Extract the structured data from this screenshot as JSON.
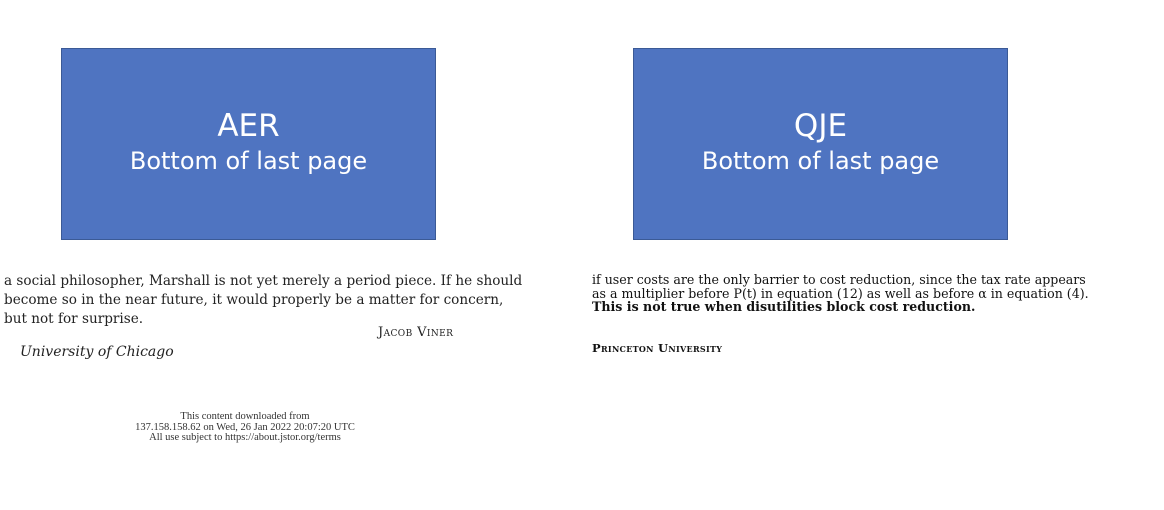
{
  "panels": {
    "aer": {
      "title": "AER",
      "subtitle": "Bottom of last page"
    },
    "qje": {
      "title": "QJE",
      "subtitle": "Bottom of last page"
    }
  },
  "aer_excerpt": {
    "lines": [
      "a social philosopher, Marshall is not yet merely a period piece. If he should",
      "become so in the near future, it would properly be a matter for concern,",
      "but not for surprise."
    ],
    "author": "Jacob Viner",
    "affiliation": "University of Chicago",
    "jstor_notice": [
      "This content downloaded from",
      "137.158.158.62 on Wed, 26 Jan 2022 20:07:20 UTC",
      "All use subject to https://about.jstor.org/terms"
    ]
  },
  "qje_excerpt": {
    "lines": [
      "if user costs are the only barrier to cost reduction, since the tax rate appears",
      "as a multiplier before P(t) in equation (12) as well as before α in equation (4).",
      "This is not true when disutilities block cost reduction."
    ],
    "affiliation": "Princeton University"
  }
}
